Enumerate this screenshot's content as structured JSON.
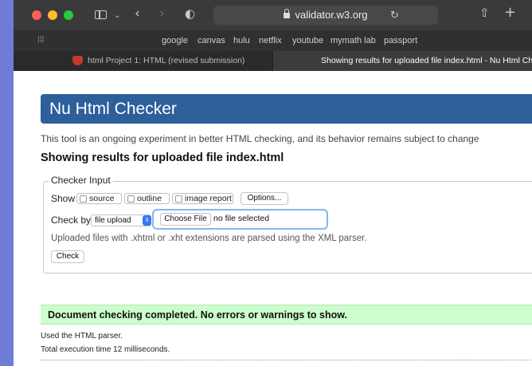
{
  "browser": {
    "traffic_lights": [
      "#ff5f57",
      "#febc2e",
      "#28c840"
    ],
    "url": "validator.w3.org",
    "icons": [
      "sidebar-icon",
      "chevron-down-icon",
      "back-icon",
      "forward-icon",
      "privacy-shield-icon",
      "lock-icon",
      "reload-icon",
      "share-icon",
      "new-tab-plus-icon",
      "grid-icon"
    ],
    "favorites": [
      "google",
      "canvas",
      "hulu",
      "netflix",
      "youtube",
      "mymath lab",
      "passport"
    ],
    "tabs": [
      {
        "title": "html Project 1: HTML (revised submission)",
        "active": false
      },
      {
        "title": "Showing results for uploaded file index.html - Nu Html Chec",
        "active": true
      }
    ]
  },
  "page": {
    "banner_title": "Nu Html Checker",
    "banner_color": "#2d5f9b",
    "intro": "This tool is an ongoing experiment in better HTML checking, and its behavior remains subject to change",
    "heading": "Showing results for uploaded file index.html",
    "checker": {
      "legend": "Checker Input",
      "show_label": "Show",
      "show_options": [
        "source",
        "outline",
        "image report"
      ],
      "options_button": "Options...",
      "check_by_label": "Check by",
      "check_by_value": "file upload",
      "choose_file_button": "Choose File",
      "file_status": "no file selected",
      "note": "Uploaded files with .xhtml or .xht extensions are parsed using the XML parser.",
      "check_button": "Check"
    },
    "result": {
      "message": "Document checking completed. No errors or warnings to show.",
      "color": "#ccffcc",
      "parser": "Used the HTML parser.",
      "time": "Total execution time 12 milliseconds."
    }
  }
}
